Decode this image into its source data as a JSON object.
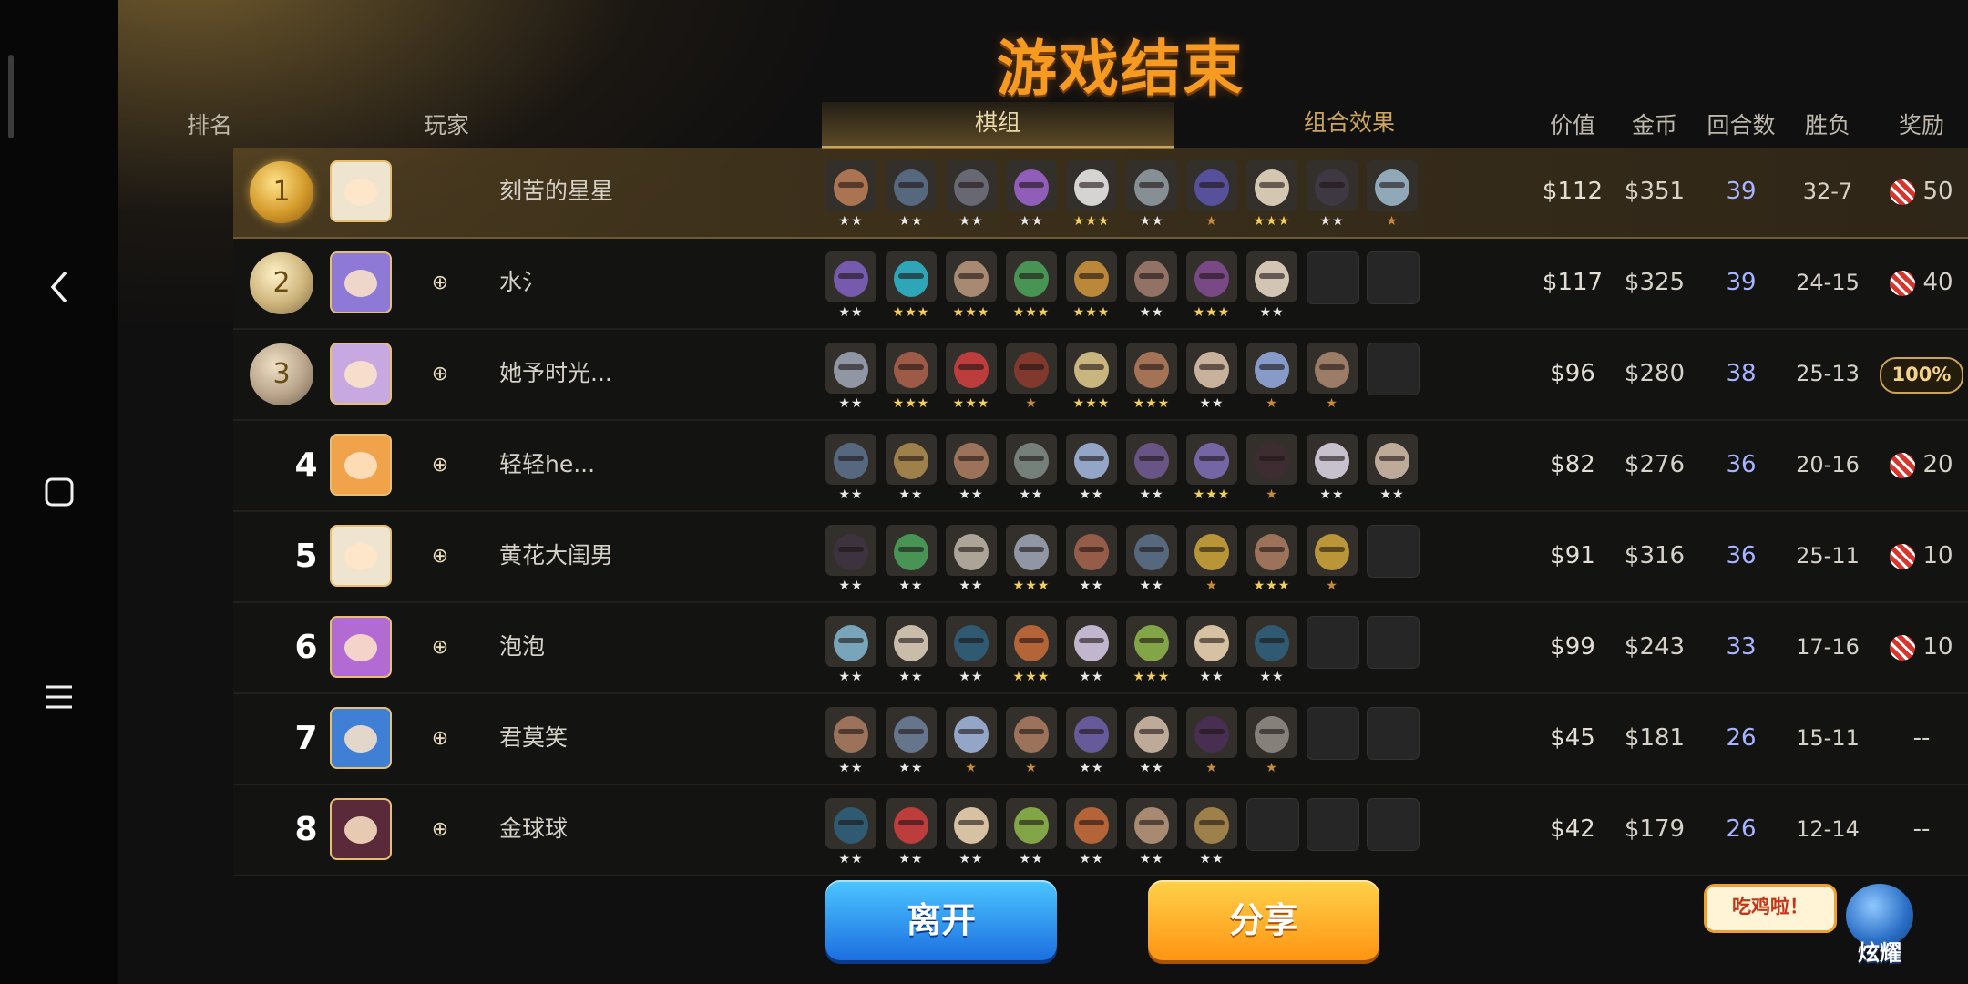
{
  "nav": {
    "back_icon": "back-icon",
    "home_icon": "home-icon",
    "menu_icon": "menu-icon"
  },
  "title": "游戏结束",
  "headers": {
    "rank": "排名",
    "player": "玩家",
    "value": "价值",
    "gold": "金币",
    "rounds": "回合数",
    "win_loss": "胜负",
    "reward": "奖励"
  },
  "tabs": {
    "lineup": "棋组",
    "traits": "组合效果",
    "active": "lineup"
  },
  "colors": {
    "title": "#f79a22",
    "rounds_text": "#a7b4ff",
    "accent_gold": "#c9a45a",
    "leave_button": "#2a8ff0",
    "share_button": "#ffae20"
  },
  "players": [
    {
      "rank": "1",
      "medal": "gold",
      "name": "刻苦的星星",
      "avatar_color": "#efe4cf",
      "friend_icon": false,
      "units": [
        {
          "c": "#b77b55",
          "s": 2
        },
        {
          "c": "#5a6f86",
          "s": 2
        },
        {
          "c": "#6d6f7a",
          "s": 2
        },
        {
          "c": "#9a63c9",
          "s": 2
        },
        {
          "c": "#e8e5e5",
          "s": 3
        },
        {
          "c": "#8f9aa0",
          "s": 2
        },
        {
          "c": "#5b55a8",
          "s": 1
        },
        {
          "c": "#e6d8c0",
          "s": 3
        },
        {
          "c": "#3e3a44",
          "s": 2
        },
        {
          "c": "#9bb6c8",
          "s": 1
        }
      ],
      "value": "$112",
      "gold": "$351",
      "rounds": "39",
      "wl": "32-7",
      "reward_type": "candy",
      "reward": "50"
    },
    {
      "rank": "2",
      "medal": "silver",
      "name": "水氵",
      "avatar_color": "#8e79d6",
      "friend_icon": true,
      "units": [
        {
          "c": "#7d5fbd",
          "s": 2
        },
        {
          "c": "#2fb4c7",
          "s": 3
        },
        {
          "c": "#b5957a",
          "s": 3
        },
        {
          "c": "#49a05a",
          "s": 3
        },
        {
          "c": "#c9923a",
          "s": 3
        },
        {
          "c": "#9b7a6a",
          "s": 2
        },
        {
          "c": "#7f4d8e",
          "s": 3
        },
        {
          "c": "#e3d6c2",
          "s": 2
        },
        {
          "c": "empty",
          "s": 0
        },
        {
          "c": "empty",
          "s": 0
        }
      ],
      "value": "$117",
      "gold": "$325",
      "rounds": "39",
      "wl": "24-15",
      "reward_type": "candy",
      "reward": "40"
    },
    {
      "rank": "3",
      "medal": "bronze",
      "name": "她予时光...",
      "avatar_color": "#c8a8e0",
      "friend_icon": true,
      "units": [
        {
          "c": "#9aa2b1",
          "s": 2
        },
        {
          "c": "#a8614a",
          "s": 3
        },
        {
          "c": "#cc3f3f",
          "s": 3
        },
        {
          "c": "#8a3b2e",
          "s": 1
        },
        {
          "c": "#d8c48a",
          "s": 3
        },
        {
          "c": "#b07a5a",
          "s": 3
        },
        {
          "c": "#d9c1a8",
          "s": 2
        },
        {
          "c": "#8fa7d8",
          "s": 1
        },
        {
          "c": "#a6856d",
          "s": 1
        },
        {
          "c": "empty",
          "s": 0
        }
      ],
      "value": "$96",
      "gold": "$280",
      "rounds": "38",
      "wl": "25-13",
      "reward_type": "badge",
      "reward": "100%"
    },
    {
      "rank": "4",
      "medal": "",
      "name": "轻轻he...",
      "avatar_color": "#f0a34a",
      "friend_icon": true,
      "units": [
        {
          "c": "#5a6f8a",
          "s": 2
        },
        {
          "c": "#a98a4e",
          "s": 2
        },
        {
          "c": "#a77b5f",
          "s": 2
        },
        {
          "c": "#7d8a84",
          "s": 2
        },
        {
          "c": "#9fb4d9",
          "s": 2
        },
        {
          "c": "#6f5a8f",
          "s": 2
        },
        {
          "c": "#7b6db3",
          "s": 3
        },
        {
          "c": "#3e2d33",
          "s": 1
        },
        {
          "c": "#d6d1de",
          "s": 2
        },
        {
          "c": "#cdb8a4",
          "s": 2
        }
      ],
      "value": "$82",
      "gold": "$276",
      "rounds": "36",
      "wl": "20-16",
      "reward_type": "candy",
      "reward": "20"
    },
    {
      "rank": "5",
      "medal": "",
      "name": "黄花大闺男",
      "avatar_color": "#efe4cf",
      "friend_icon": true,
      "units": [
        {
          "c": "#3e3440",
          "s": 2
        },
        {
          "c": "#49a05a",
          "s": 2
        },
        {
          "c": "#b9b1a3",
          "s": 2
        },
        {
          "c": "#9aa2b1",
          "s": 3
        },
        {
          "c": "#a0624e",
          "s": 2
        },
        {
          "c": "#5a6f86",
          "s": 2
        },
        {
          "c": "#c7a23a",
          "s": 1
        },
        {
          "c": "#a77b5f",
          "s": 3
        },
        {
          "c": "#c9a23a",
          "s": 1
        },
        {
          "c": "empty",
          "s": 0
        }
      ],
      "value": "$91",
      "gold": "$316",
      "rounds": "36",
      "wl": "25-11",
      "reward_type": "candy",
      "reward": "10"
    },
    {
      "rank": "6",
      "medal": "",
      "name": "泡泡",
      "avatar_color": "#b36bd4",
      "friend_icon": true,
      "units": [
        {
          "c": "#7fb3c9",
          "s": 2
        },
        {
          "c": "#d9ccb8",
          "s": 2
        },
        {
          "c": "#2f5f7a",
          "s": 2
        },
        {
          "c": "#c36a3a",
          "s": 3
        },
        {
          "c": "#cfc6e0",
          "s": 2
        },
        {
          "c": "#8ab24a",
          "s": 3
        },
        {
          "c": "#e8d2b0",
          "s": 2
        },
        {
          "c": "#2f5f7a",
          "s": 2
        },
        {
          "c": "empty",
          "s": 0
        },
        {
          "c": "empty",
          "s": 0
        }
      ],
      "value": "$99",
      "gold": "$243",
      "rounds": "33",
      "wl": "17-16",
      "reward_type": "candy",
      "reward": "10"
    },
    {
      "rank": "7",
      "medal": "",
      "name": "君莫笑",
      "avatar_color": "#3f7fd6",
      "friend_icon": true,
      "units": [
        {
          "c": "#a77b5f",
          "s": 2
        },
        {
          "c": "#6a7d96",
          "s": 2
        },
        {
          "c": "#9fb4d9",
          "s": 1
        },
        {
          "c": "#a77b5f",
          "s": 1
        },
        {
          "c": "#6d5fa6",
          "s": 2
        },
        {
          "c": "#cdb8a4",
          "s": 2
        },
        {
          "c": "#4a2f55",
          "s": 1
        },
        {
          "c": "#8f8a84",
          "s": 1
        },
        {
          "c": "empty",
          "s": 0
        },
        {
          "c": "empty",
          "s": 0
        }
      ],
      "value": "$45",
      "gold": "$181",
      "rounds": "26",
      "wl": "15-11",
      "reward_type": "none",
      "reward": "--"
    },
    {
      "rank": "8",
      "medal": "",
      "name": "金球球",
      "avatar_color": "#5a2a3a",
      "friend_icon": true,
      "units": [
        {
          "c": "#2f5f7a",
          "s": 2
        },
        {
          "c": "#cc3f3f",
          "s": 2
        },
        {
          "c": "#e8d2b0",
          "s": 2
        },
        {
          "c": "#8ab24a",
          "s": 2
        },
        {
          "c": "#c36a3a",
          "s": 2
        },
        {
          "c": "#b5957a",
          "s": 2
        },
        {
          "c": "#a98a4e",
          "s": 2
        },
        {
          "c": "empty",
          "s": 0
        },
        {
          "c": "empty",
          "s": 0
        },
        {
          "c": "empty",
          "s": 0
        }
      ],
      "value": "$42",
      "gold": "$179",
      "rounds": "26",
      "wl": "12-14",
      "reward_type": "none",
      "reward": "--"
    }
  ],
  "buttons": {
    "leave": "离开",
    "share": "分享"
  },
  "showoff": {
    "bubble": "吃鸡啦！",
    "label": "炫耀"
  }
}
